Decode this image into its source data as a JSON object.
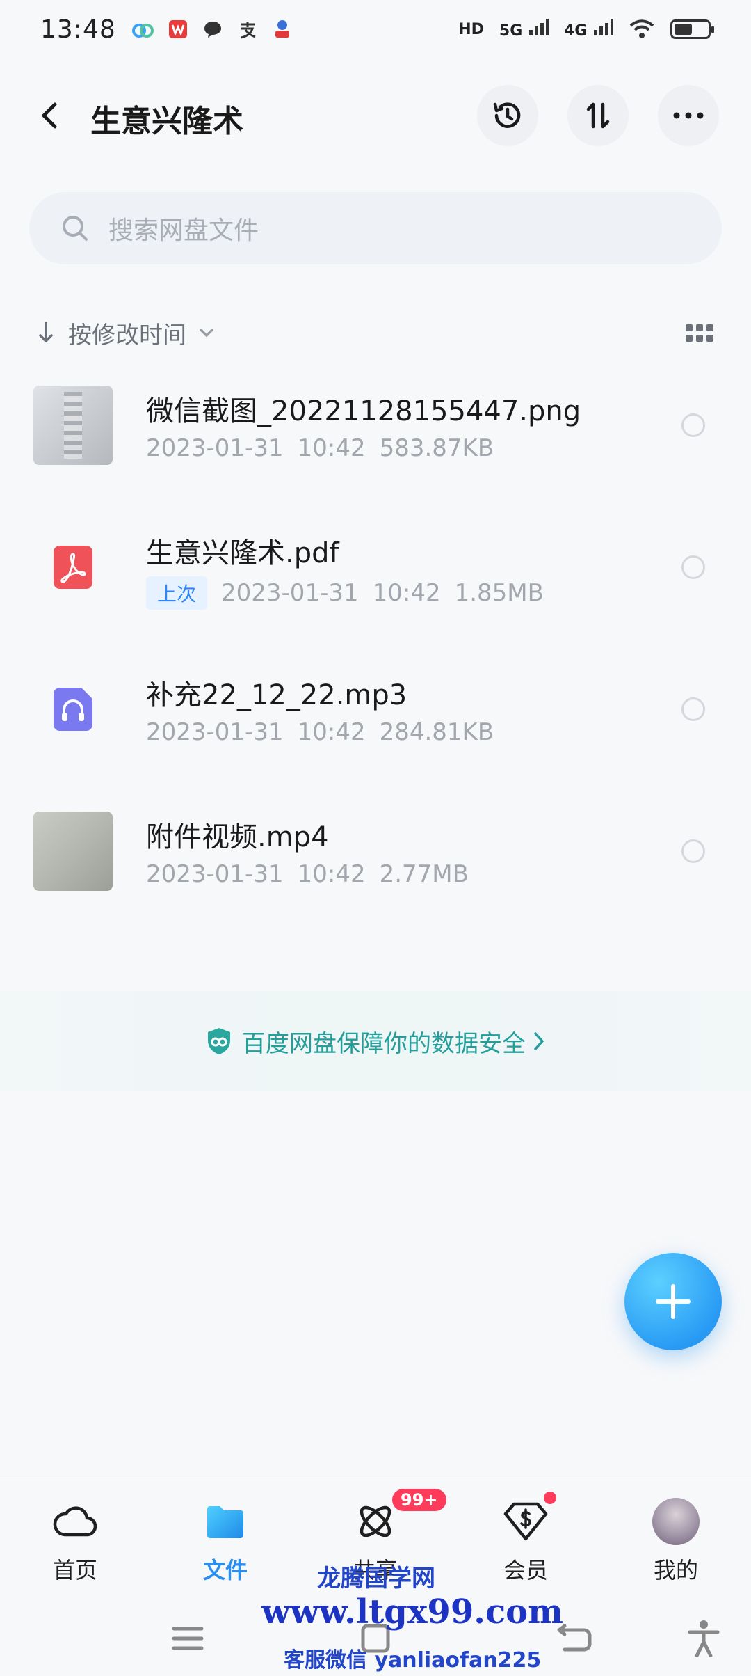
{
  "status_bar": {
    "time": "13:48",
    "notification_icons": [
      "cloud-app-icon",
      "wps-icon",
      "chat-icon",
      "alipay-icon",
      "mascot-app-icon"
    ],
    "network_labels": [
      "HD",
      "5G",
      "4G"
    ],
    "battery_level": 0.55
  },
  "header": {
    "title": "生意兴隆术",
    "actions": [
      "history-icon",
      "sort-icon",
      "more-icon"
    ]
  },
  "search": {
    "placeholder": "搜索网盘文件"
  },
  "sort": {
    "label": "按修改时间"
  },
  "files": [
    {
      "name": "微信截图_20221128155447.png",
      "date": "2023-01-31",
      "time": "10:42",
      "size": "583.87KB",
      "type": "image",
      "badge": ""
    },
    {
      "name": "生意兴隆术.pdf",
      "date": "2023-01-31",
      "time": "10:42",
      "size": "1.85MB",
      "type": "pdf",
      "badge": "上次"
    },
    {
      "name": "补充22_12_22.mp3",
      "date": "2023-01-31",
      "time": "10:42",
      "size": "284.81KB",
      "type": "audio",
      "badge": ""
    },
    {
      "name": "附件视频.mp4",
      "date": "2023-01-31",
      "time": "10:42",
      "size": "2.77MB",
      "type": "video",
      "badge": ""
    }
  ],
  "security_banner": {
    "text": "百度网盘保障你的数据安全"
  },
  "bottom_nav": {
    "items": [
      {
        "label": "首页"
      },
      {
        "label": "文件"
      },
      {
        "label": "共享",
        "badge": "99+"
      },
      {
        "label": "会员"
      },
      {
        "label": "我的"
      }
    ]
  },
  "watermark": {
    "line1": "龙腾国学网",
    "line2": "www.ltgx99.com",
    "line3": "客服微信 yanliaofan225"
  },
  "colors": {
    "accent": "#2a8ff0",
    "badge_red": "#ff3b5c",
    "security_teal": "#239e9a",
    "pdf_red": "#f0525a",
    "audio_purple": "#7b79f0"
  }
}
